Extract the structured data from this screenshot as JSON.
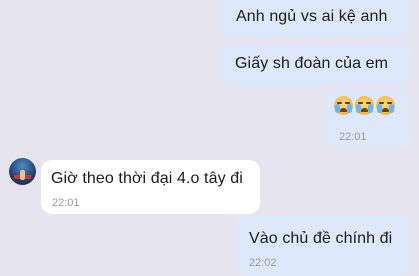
{
  "messages": [
    {
      "direction": "outgoing",
      "text": "Anh ngủ vs ai kệ anh"
    },
    {
      "direction": "outgoing",
      "text": "Giấy sh đoàn của em"
    },
    {
      "direction": "outgoing",
      "emoji": [
        "crying-face",
        "crying-face",
        "crying-face"
      ],
      "time": "22:01"
    },
    {
      "direction": "incoming",
      "text": "Giờ theo thời đại 4.o tây đi",
      "time": "22:01"
    },
    {
      "direction": "outgoing",
      "text": "Vào chủ đề chính đi",
      "time": "22:02"
    }
  ],
  "colors": {
    "background": "#e6e5ef",
    "outgoing_bubble": "#dde9fb",
    "incoming_bubble": "#ffffff",
    "timestamp": "#9a9aa3"
  }
}
